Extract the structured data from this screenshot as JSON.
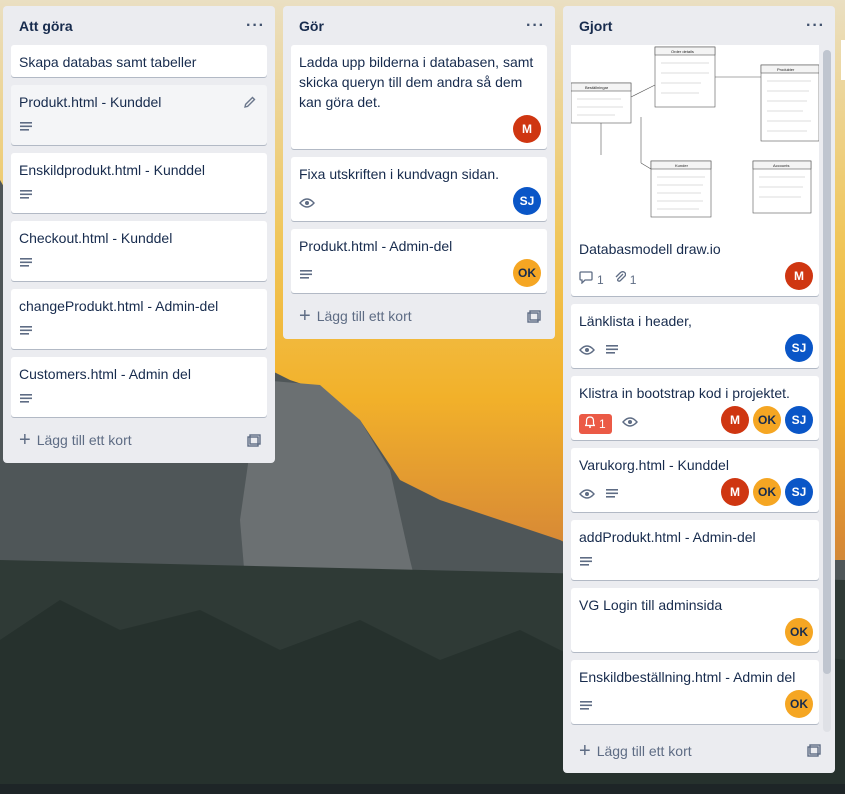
{
  "lists": [
    {
      "title": "Att göra",
      "add_label": "Lägg till ett kort",
      "cards": [
        {
          "title": "Skapa databas samt tabeller"
        },
        {
          "title": "Produkt.html - Kunddel"
        },
        {
          "title": "Enskildprodukt.html - Kunddel"
        },
        {
          "title": "Checkout.html - Kunddel"
        },
        {
          "title": "changeProdukt.html - Admin-del"
        },
        {
          "title": "Customers.html - Admin del"
        }
      ]
    },
    {
      "title": "Gör",
      "add_label": "Lägg till ett kort",
      "cards": [
        {
          "title": "Ladda upp bilderna i databasen, samt skicka queryn till dem andra så dem kan göra det.",
          "members": [
            "M"
          ]
        },
        {
          "title": "Fixa utskriften i kundvagn sidan.",
          "members": [
            "SJ"
          ]
        },
        {
          "title": "Produkt.html - Admin-del",
          "members": [
            "OK"
          ]
        }
      ]
    },
    {
      "title": "Gjort",
      "add_label": "Lägg till ett kort",
      "cards": [
        {
          "title": "Databasmodell draw.io",
          "comments": "1",
          "attachments": "1",
          "members": [
            "M"
          ],
          "diagram": {
            "t1": "Order details",
            "t2": "Beställningar",
            "t3": "Produkter",
            "t4": "Kunder",
            "t5": "Accounts"
          }
        },
        {
          "title": "Länklista i header,",
          "members": [
            "SJ"
          ]
        },
        {
          "title": "Klistra in bootstrap kod i projektet.",
          "notifications": "1",
          "members": [
            "M",
            "OK",
            "SJ"
          ]
        },
        {
          "title": "Varukorg.html - Kunddel",
          "members": [
            "M",
            "OK",
            "SJ"
          ]
        },
        {
          "title": "addProdukt.html - Admin-del"
        },
        {
          "title": "VG Login till adminsida",
          "members": [
            "OK"
          ]
        },
        {
          "title": "Enskildbeställning.html - Admin del",
          "members": [
            "OK"
          ]
        }
      ]
    }
  ],
  "colors": {
    "list_bg": "#ebecf0",
    "card_bg": "#ffffff",
    "avatar_M": "#cf3611",
    "avatar_SJ": "#0a56c7",
    "avatar_OK": "#f5a623",
    "notification": "#eb5a46"
  },
  "icons": [
    "ellipsis-icon",
    "pencil-icon",
    "description-icon",
    "eye-icon",
    "comment-icon",
    "paperclip-icon",
    "bell-icon",
    "plus-icon",
    "template-icon"
  ]
}
